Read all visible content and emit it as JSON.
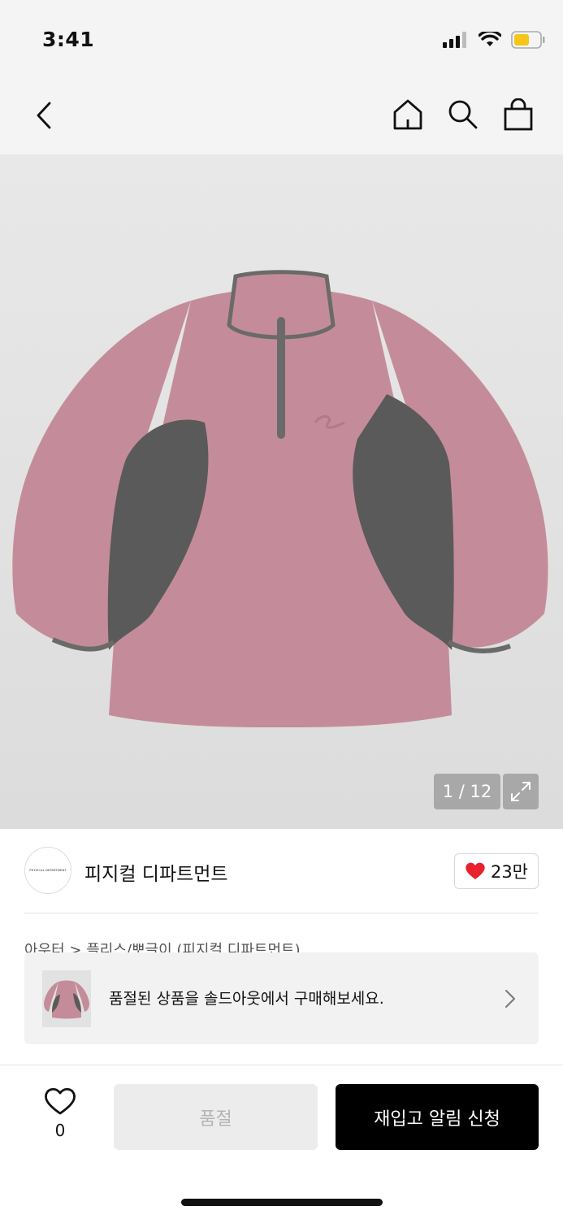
{
  "status": {
    "time": "3:41"
  },
  "gallery": {
    "counter": "1 / 12"
  },
  "brand": {
    "logo_text": "PHYSICAL DEPARTMENT",
    "name": "피지컬 디파트먼트",
    "likes": "23만"
  },
  "category": {
    "text": "아우터 > 플리스/뽀글이 (피지컬 디파트먼트)"
  },
  "banner": {
    "text": "품절된 상품을 솔드아웃에서 구매해보세요."
  },
  "actions": {
    "wish_count": "0",
    "soldout_label": "품절",
    "restock_label": "재입고 알림 신청"
  },
  "colors": {
    "accent": "#000000",
    "heart": "#e8212d",
    "battery": "#f5c518",
    "fleece": "#c48c9a",
    "panel": "#5a5a5a"
  }
}
